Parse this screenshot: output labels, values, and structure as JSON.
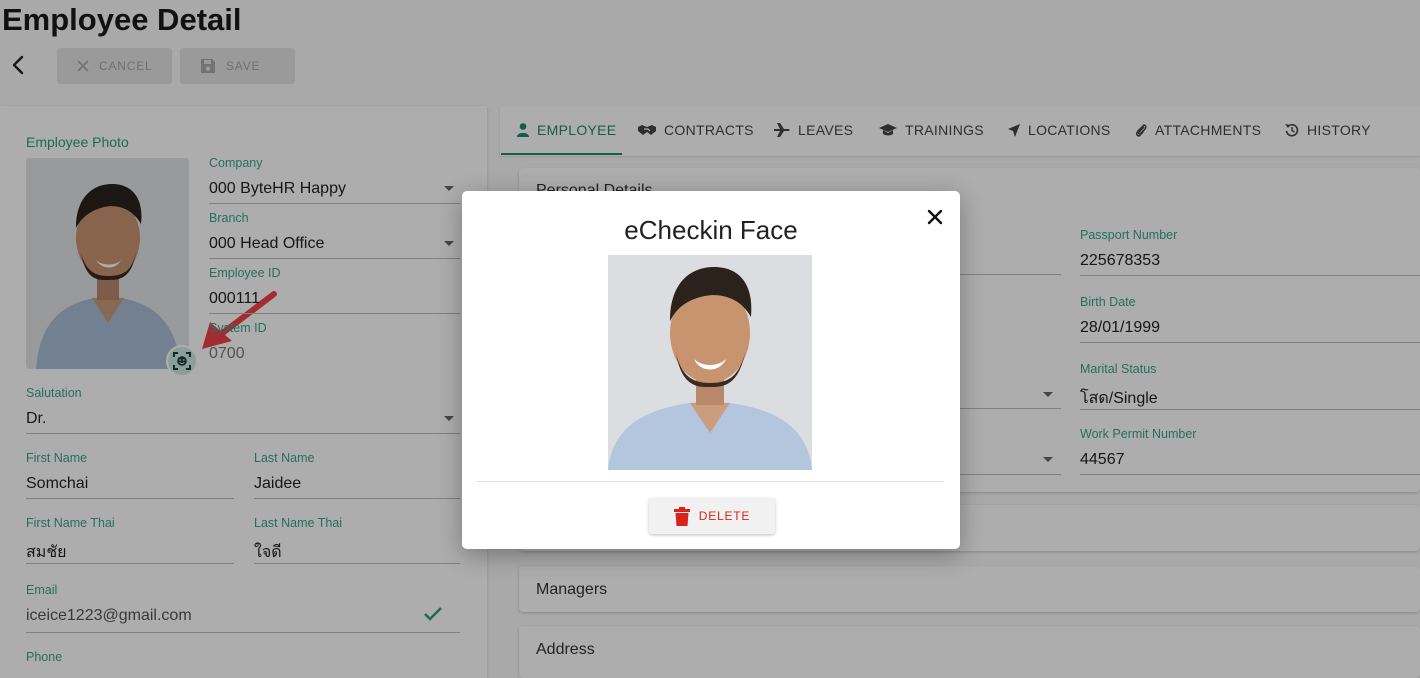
{
  "header": {
    "title": "Employee Detail",
    "cancel_label": "CANCEL",
    "save_label": "SAVE"
  },
  "left": {
    "photo_label": "Employee Photo",
    "company_label": "Company",
    "company_value": "000 ByteHR Happy",
    "branch_label": "Branch",
    "branch_value": "000 Head Office",
    "employee_id_label": "Employee ID",
    "employee_id_value": "000111",
    "system_id_label": "System ID",
    "system_id_value": "0700",
    "salutation_label": "Salutation",
    "salutation_value": "Dr.",
    "first_name_label": "First Name",
    "first_name_value": "Somchai",
    "last_name_label": "Last Name",
    "last_name_value": "Jaidee",
    "first_name_thai_label": "First Name Thai",
    "first_name_thai_value": "สมชัย",
    "last_name_thai_label": "Last Name Thai",
    "last_name_thai_value": "ใจดี",
    "email_label": "Email",
    "email_value": "iceice1223@gmail.com",
    "phone_label": "Phone"
  },
  "tabs": [
    {
      "label": "EMPLOYEE",
      "icon": "person-icon"
    },
    {
      "label": "CONTRACTS",
      "icon": "handshake-icon"
    },
    {
      "label": "LEAVES",
      "icon": "airplane-icon"
    },
    {
      "label": "TRAININGS",
      "icon": "graduation-cap-icon"
    },
    {
      "label": "LOCATIONS",
      "icon": "location-arrow-icon"
    },
    {
      "label": "ATTACHMENTS",
      "icon": "paperclip-icon"
    },
    {
      "label": "HISTORY",
      "icon": "history-icon"
    }
  ],
  "personal": {
    "title": "Personal Details",
    "passport_label": "Passport Number",
    "passport_value": "225678353",
    "birth_label": "Birth Date",
    "birth_value": "28/01/1999",
    "marital_label": "Marital Status",
    "marital_value": "โสด/Single",
    "work_permit_label": "Work Permit Number",
    "work_permit_value": "44567"
  },
  "managers_title": "Managers",
  "address_title": "Address",
  "modal": {
    "title": "eCheckin Face",
    "delete_label": "DELETE"
  },
  "colors": {
    "accent": "#1f8a6f",
    "label_green": "#3aa38a",
    "danger": "#d9241b",
    "arrow": "#f0414b"
  }
}
